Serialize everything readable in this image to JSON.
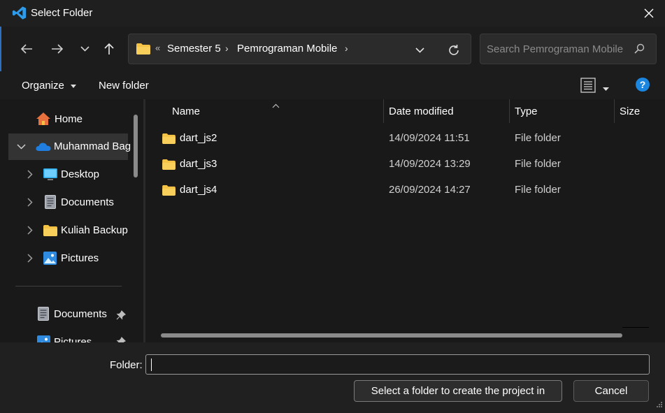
{
  "window": {
    "title": "Select Folder",
    "icons": {
      "app": "vscode-icon",
      "close": "close-icon"
    }
  },
  "nav": {
    "back_icon": "arrow-left-icon",
    "forward_icon": "arrow-right-icon",
    "recent_icon": "chevron-down-icon",
    "up_icon": "arrow-up-icon"
  },
  "address": {
    "overflow": "«",
    "crumbs": [
      "Semester 5",
      "Pemrograman Mobile"
    ],
    "separator": "›"
  },
  "search": {
    "placeholder": "Search Pemrograman Mobile"
  },
  "toolbar": {
    "organize_label": "Organize",
    "new_folder_label": "New folder"
  },
  "sidebar": {
    "items": [
      {
        "label": "Home",
        "icon": "home-icon"
      },
      {
        "label": "Muhammad Bag",
        "icon": "onedrive-cloud-icon",
        "expanded": true,
        "selected": true
      },
      {
        "label": "Desktop",
        "icon": "desktop-icon"
      },
      {
        "label": "Documents",
        "icon": "document-icon"
      },
      {
        "label": "Kuliah Backup",
        "icon": "folder-icon"
      },
      {
        "label": "Pictures",
        "icon": "pictures-icon"
      }
    ],
    "quick_access": [
      {
        "label": "Documents",
        "icon": "document-icon",
        "pinned": true
      },
      {
        "label": "Pictures",
        "icon": "pictures-icon",
        "pinned": true
      }
    ]
  },
  "columns": [
    "Name",
    "Date modified",
    "Type",
    "Size"
  ],
  "files": [
    {
      "name": "dart_js2",
      "date": "14/09/2024 11:51",
      "type": "File folder"
    },
    {
      "name": "dart_js3",
      "date": "14/09/2024 13:29",
      "type": "File folder"
    },
    {
      "name": "dart_js4",
      "date": "26/09/2024 14:27",
      "type": "File folder"
    }
  ],
  "footer": {
    "folder_label": "Folder:",
    "folder_value": "",
    "primary_label": "Select a folder to create the project in",
    "cancel_label": "Cancel"
  },
  "colors": {
    "background": "#191919",
    "accent": "#0078d4",
    "folder": "#f4c244",
    "help": "#1a86e0"
  }
}
